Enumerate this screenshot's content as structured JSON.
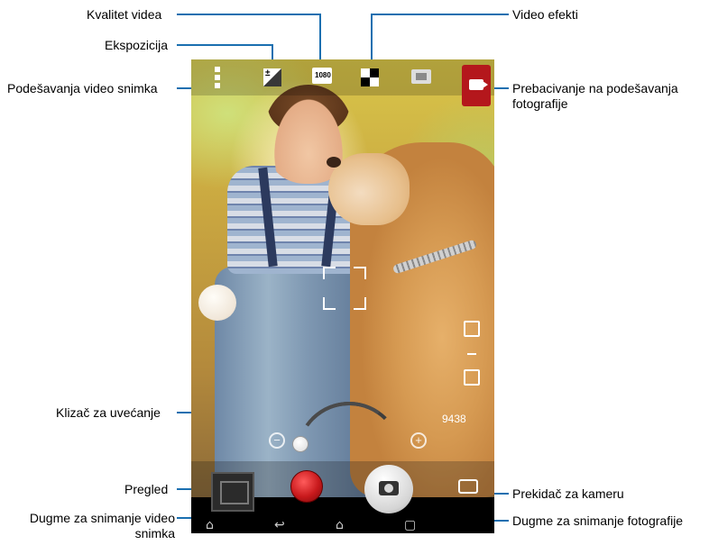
{
  "annotations": {
    "video_quality": "Kvalitet videa",
    "exposure": "Ekspozicija",
    "video_settings": "Podešavanja video snimka",
    "video_effects": "Video efekti",
    "switch_photo_settings": "Prebacivanje na podešavanja fotografije",
    "zoom_slider": "Klizač za uvećanje",
    "review": "Pregled",
    "record_video_button": "Dugme za snimanje video snimka",
    "camera_switch": "Prekidač za kameru",
    "photo_button": "Dugme za snimanje fotografije"
  },
  "camera": {
    "counter": "9438",
    "quality_badge": "1080",
    "exposure_badge": "±",
    "zoom_minus": "−",
    "zoom_plus": "+"
  },
  "icons": {
    "settings": "settings-icon",
    "exposure": "exposure-icon",
    "quality": "video-quality-icon",
    "effects": "video-effects-icon",
    "film": "film-icon",
    "mode": "photo-mode-icon",
    "nav_menu": "⌂",
    "nav_back": "↩",
    "nav_home": "⌂",
    "nav_recent": "▢"
  },
  "colors": {
    "leader": "#1a6fb0",
    "record": "#c8191c",
    "mode_button": "#b4171c"
  }
}
